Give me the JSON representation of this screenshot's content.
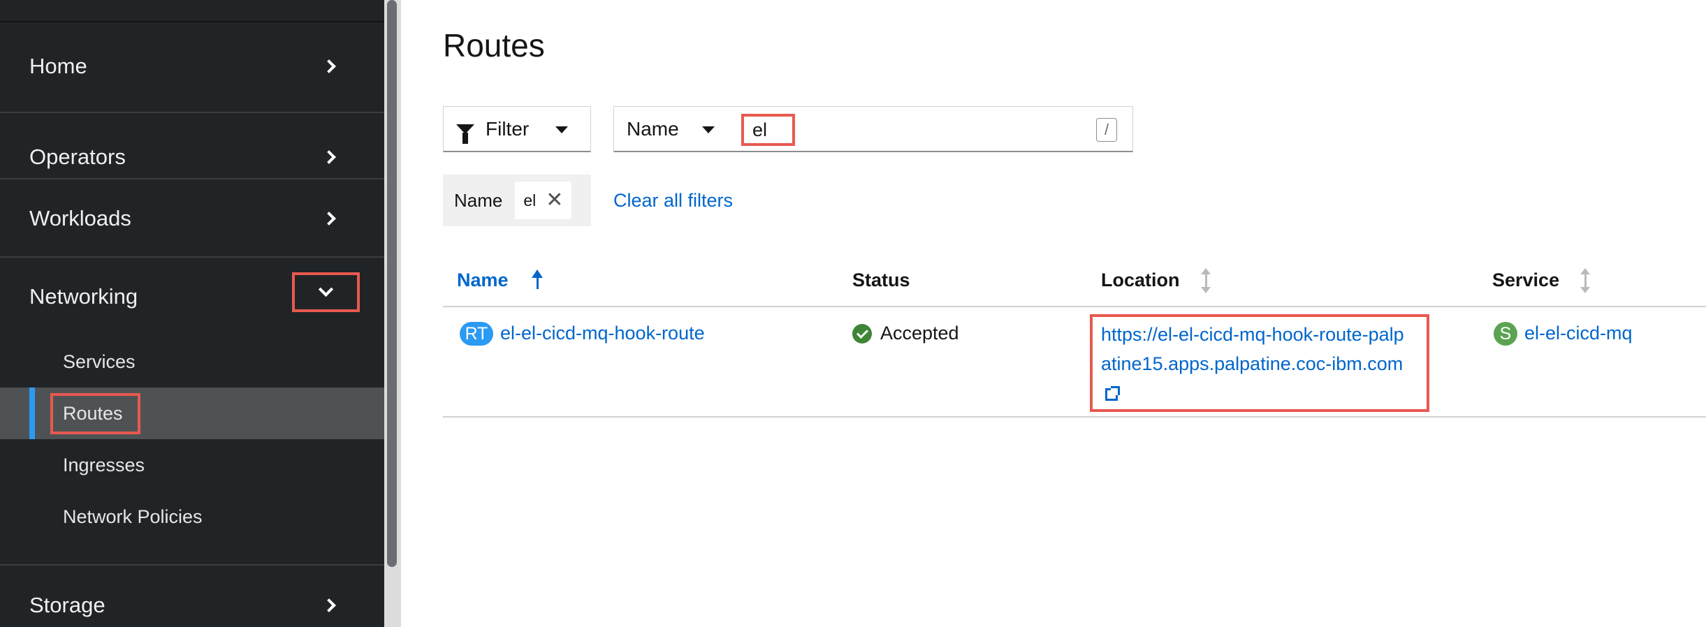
{
  "sidebar": {
    "sections": {
      "home": "Home",
      "operators": "Operators",
      "workloads": "Workloads",
      "networking": "Networking",
      "storage": "Storage"
    },
    "networking_items": {
      "services": "Services",
      "routes": "Routes",
      "ingresses": "Ingresses",
      "network_policies": "Network Policies"
    }
  },
  "page": {
    "title": "Routes"
  },
  "toolbar": {
    "filter_label": "Filter",
    "name_dropdown": "Name",
    "search_value": "el",
    "shortcut_key": "/"
  },
  "chips": {
    "category": "Name",
    "value": "el",
    "clear_all": "Clear all filters"
  },
  "table": {
    "columns": {
      "name": "Name",
      "status": "Status",
      "location": "Location",
      "service": "Service"
    },
    "rows": [
      {
        "name_badge": "RT",
        "name": "el-el-cicd-mq-hook-route",
        "status": "Accepted",
        "location": "https://el-el-cicd-mq-hook-route-palpatine15.apps.palpatine.coc-ibm.com",
        "service_badge": "S",
        "service": "el-el-cicd-mq"
      }
    ]
  },
  "colors": {
    "sidebar_bg": "#212427",
    "active_accent": "#2b9af3",
    "link": "#0066cc",
    "highlight": "#e8594f",
    "route_badge": "#2b9af3",
    "service_badge": "#5ba352",
    "status_ok": "#3e8635"
  }
}
